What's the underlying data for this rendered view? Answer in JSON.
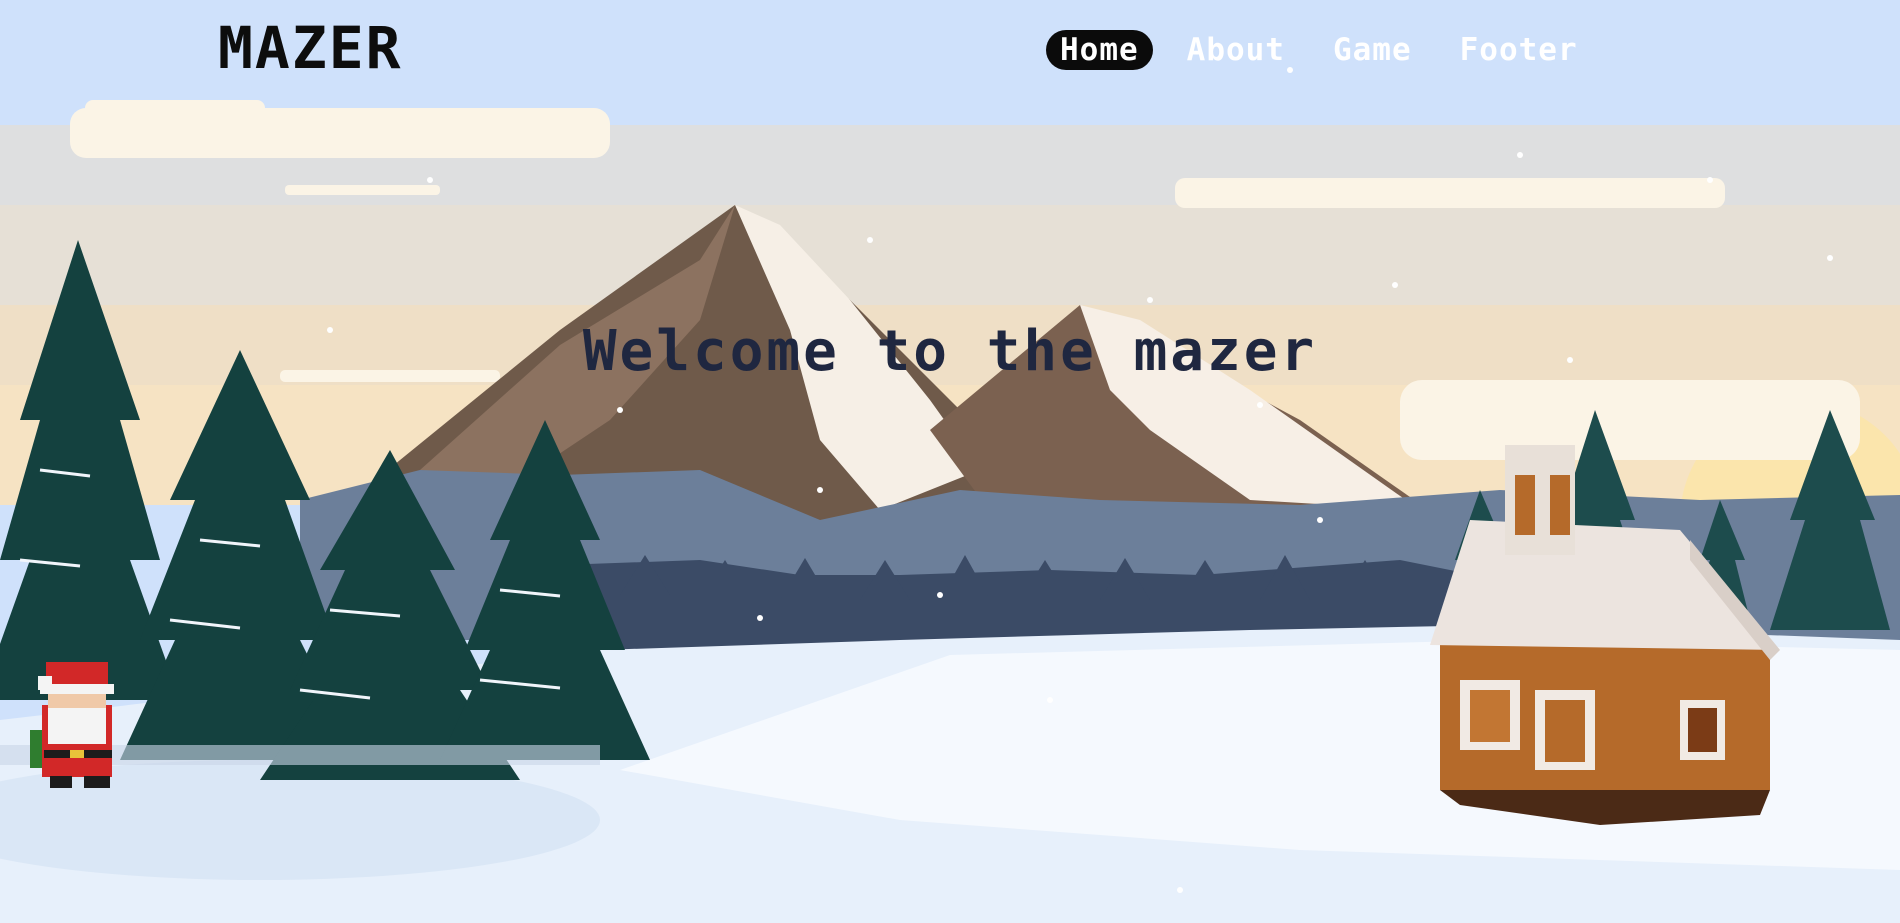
{
  "header": {
    "logo": "MAZER",
    "nav": [
      {
        "label": "Home",
        "active": true
      },
      {
        "label": "About",
        "active": false
      },
      {
        "label": "Game",
        "active": false
      },
      {
        "label": "Footer",
        "active": false
      }
    ]
  },
  "hero": {
    "title": "Welcome to the mazer"
  },
  "colors": {
    "sky": "#cfe1fb",
    "nav_active_bg": "#0b0b0b",
    "title": "#1f2740",
    "pine": "#14413f",
    "snow": "#f2f7fd"
  }
}
